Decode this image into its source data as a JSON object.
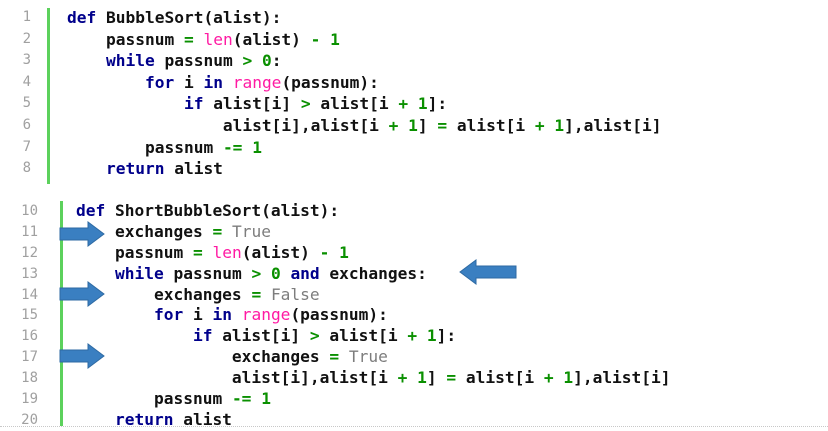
{
  "colors": {
    "keyword": "#00008b",
    "builtin": "#ff1aa3",
    "number": "#0a9000",
    "constant": "#7d7d7d",
    "gutter": "#5cd15c",
    "arrow": "#3a7fc1"
  },
  "blocks": [
    {
      "lines": [
        {
          "n": "1",
          "tokens": [
            [
              "kw",
              "def "
            ],
            [
              "tx",
              "BubbleSort(alist):"
            ]
          ]
        },
        {
          "n": "2",
          "tokens": [
            [
              "tx",
              "    passnum "
            ],
            [
              "op",
              "="
            ],
            [
              "tx",
              " "
            ],
            [
              "bi",
              "len"
            ],
            [
              "tx",
              "(alist) "
            ],
            [
              "op",
              "-"
            ],
            [
              "tx",
              " "
            ],
            [
              "num",
              "1"
            ]
          ]
        },
        {
          "n": "3",
          "tokens": [
            [
              "kw",
              "    while "
            ],
            [
              "tx",
              "passnum "
            ],
            [
              "op",
              ">"
            ],
            [
              "tx",
              " "
            ],
            [
              "num",
              "0"
            ],
            [
              "tx",
              ":"
            ]
          ]
        },
        {
          "n": "4",
          "tokens": [
            [
              "kw",
              "        for "
            ],
            [
              "tx",
              "i "
            ],
            [
              "kw",
              "in "
            ],
            [
              "bi",
              "range"
            ],
            [
              "tx",
              "(passnum):"
            ]
          ]
        },
        {
          "n": "5",
          "tokens": [
            [
              "kw",
              "            if "
            ],
            [
              "tx",
              "alist[i] "
            ],
            [
              "op",
              ">"
            ],
            [
              "tx",
              " alist[i "
            ],
            [
              "op",
              "+"
            ],
            [
              "tx",
              " "
            ],
            [
              "num",
              "1"
            ],
            [
              "tx",
              "]:"
            ]
          ]
        },
        {
          "n": "6",
          "tokens": [
            [
              "tx",
              "                alist[i],alist[i "
            ],
            [
              "op",
              "+"
            ],
            [
              "tx",
              " "
            ],
            [
              "num",
              "1"
            ],
            [
              "tx",
              "] "
            ],
            [
              "op",
              "="
            ],
            [
              "tx",
              " alist[i "
            ],
            [
              "op",
              "+"
            ],
            [
              "tx",
              " "
            ],
            [
              "num",
              "1"
            ],
            [
              "tx",
              "],alist[i]"
            ]
          ]
        },
        {
          "n": "7",
          "tokens": [
            [
              "tx",
              "        passnum "
            ],
            [
              "op",
              "-="
            ],
            [
              "tx",
              " "
            ],
            [
              "num",
              "1"
            ]
          ]
        },
        {
          "n": "8",
          "tokens": [
            [
              "kw",
              "    return "
            ],
            [
              "tx",
              "alist"
            ]
          ]
        }
      ]
    },
    {
      "lines": [
        {
          "n": "10",
          "tokens": [
            [
              "kw",
              "def "
            ],
            [
              "tx",
              "ShortBubbleSort(alist):"
            ]
          ]
        },
        {
          "n": "11",
          "tokens": [
            [
              "tx",
              "    exchanges "
            ],
            [
              "op",
              "="
            ],
            [
              "tx",
              " "
            ],
            [
              "kc",
              "True"
            ]
          ]
        },
        {
          "n": "12",
          "tokens": [
            [
              "tx",
              "    passnum "
            ],
            [
              "op",
              "="
            ],
            [
              "tx",
              " "
            ],
            [
              "bi",
              "len"
            ],
            [
              "tx",
              "(alist) "
            ],
            [
              "op",
              "-"
            ],
            [
              "tx",
              " "
            ],
            [
              "num",
              "1"
            ]
          ]
        },
        {
          "n": "13",
          "tokens": [
            [
              "kw",
              "    while "
            ],
            [
              "tx",
              "passnum "
            ],
            [
              "op",
              ">"
            ],
            [
              "tx",
              " "
            ],
            [
              "num",
              "0"
            ],
            [
              "tx",
              " "
            ],
            [
              "kw",
              "and "
            ],
            [
              "tx",
              "exchanges:"
            ]
          ]
        },
        {
          "n": "14",
          "tokens": [
            [
              "tx",
              "        exchanges "
            ],
            [
              "op",
              "="
            ],
            [
              "tx",
              " "
            ],
            [
              "kc",
              "False"
            ]
          ]
        },
        {
          "n": "15",
          "tokens": [
            [
              "kw",
              "        for "
            ],
            [
              "tx",
              "i "
            ],
            [
              "kw",
              "in "
            ],
            [
              "bi",
              "range"
            ],
            [
              "tx",
              "(passnum):"
            ]
          ]
        },
        {
          "n": "16",
          "tokens": [
            [
              "kw",
              "            if "
            ],
            [
              "tx",
              "alist[i] "
            ],
            [
              "op",
              ">"
            ],
            [
              "tx",
              " alist[i "
            ],
            [
              "op",
              "+"
            ],
            [
              "tx",
              " "
            ],
            [
              "num",
              "1"
            ],
            [
              "tx",
              "]:"
            ]
          ]
        },
        {
          "n": "17",
          "tokens": [
            [
              "tx",
              "                exchanges "
            ],
            [
              "op",
              "="
            ],
            [
              "tx",
              " "
            ],
            [
              "kc",
              "True"
            ]
          ]
        },
        {
          "n": "18",
          "tokens": [
            [
              "tx",
              "                alist[i],alist[i "
            ],
            [
              "op",
              "+"
            ],
            [
              "tx",
              " "
            ],
            [
              "num",
              "1"
            ],
            [
              "tx",
              "] "
            ],
            [
              "op",
              "="
            ],
            [
              "tx",
              " alist[i "
            ],
            [
              "op",
              "+"
            ],
            [
              "tx",
              " "
            ],
            [
              "num",
              "1"
            ],
            [
              "tx",
              "],alist[i]"
            ]
          ]
        },
        {
          "n": "19",
          "tokens": [
            [
              "tx",
              "        passnum "
            ],
            [
              "op",
              "-="
            ],
            [
              "tx",
              " "
            ],
            [
              "num",
              "1"
            ]
          ]
        },
        {
          "n": "20",
          "tokens": [
            [
              "kw",
              "    return "
            ],
            [
              "tx",
              "alist"
            ]
          ]
        }
      ]
    }
  ],
  "annotations": [
    {
      "icon": "arrow-right-icon",
      "line": "11"
    },
    {
      "icon": "arrow-left-icon",
      "line": "13"
    },
    {
      "icon": "arrow-right-icon",
      "line": "14"
    },
    {
      "icon": "arrow-right-icon",
      "line": "17"
    }
  ]
}
